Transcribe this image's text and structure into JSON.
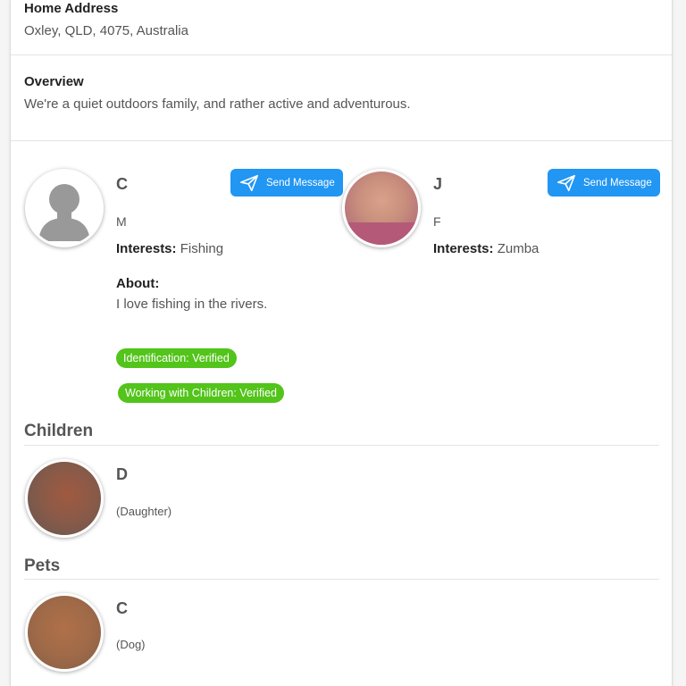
{
  "home_address": {
    "label": "Home Address",
    "value": "Oxley, QLD, 4075, Australia"
  },
  "overview": {
    "label": "Overview",
    "value": "We're a quiet outdoors family, and rather active and adventurous."
  },
  "parents": [
    {
      "name": "C",
      "gender": "M",
      "interests_label": "Interests:",
      "interests": "Fishing",
      "about_label": "About:",
      "about": "I love fishing in the rivers.",
      "message_button": "Send Message",
      "badges": [
        "Identification: Verified",
        "Working with Children: Verified"
      ]
    },
    {
      "name": "J",
      "gender": "F",
      "interests_label": "Interests:",
      "interests": "Zumba",
      "message_button": "Send Message"
    }
  ],
  "children": {
    "heading": "Children",
    "items": [
      {
        "name": "D",
        "relation": "(Daughter)"
      }
    ]
  },
  "pets": {
    "heading": "Pets",
    "items": [
      {
        "name": "C",
        "kind": "(Dog)"
      }
    ]
  },
  "colors": {
    "accent": "#2196f3",
    "verified": "#52c41a"
  }
}
